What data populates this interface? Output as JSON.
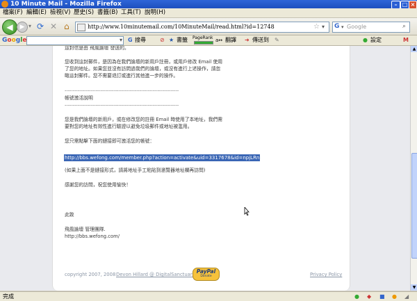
{
  "window": {
    "title": "10 Minute Mail - Mozilla Firefox"
  },
  "menu": [
    "檔案(F)",
    "編輯(E)",
    "檢視(V)",
    "歷史(S)",
    "書籤(B)",
    "工具(T)",
    "說明(H)"
  ],
  "nav": {
    "url": "http://www.10minutemail.com/10MinuteMail/read.html?id=12748",
    "search_placeholder": "Google",
    "search_engine": "G"
  },
  "google_toolbar": {
    "logo": "Google",
    "search_label": "搜尋",
    "bookmarks_label": "書籤",
    "pagerank_label": "PageRank",
    "translate_label": "翻譯",
    "sendto_label": "傳送到",
    "settings_label": "設定",
    "gmail_label": "M"
  },
  "mail": {
    "top_line": "這封信是由 飛風論壇 發送的。",
    "para1": [
      "您收到這封郵件，是因為在我們論壇的新用戶註冊，或用戶修改 Email 使用",
      "了您的地址。如果您並沒有訪問過我們的論壇，或沒有進行上述操作，請忽",
      "略這封郵件。您不需要退訂或進行其他進一步的操作。"
    ],
    "separator": "----------------------------------------------------------------------",
    "section_title": "帳號激活說明",
    "para2": [
      "您是我們論壇的新用戶，或在修改您的註冊 Email 時使用了本地址，我們需",
      "要對您的地址有效性進行驗證以避免垃圾郵件或地址被濫用。"
    ],
    "para3": "您只需點擊下面的鏈接即可激活您的帳號：",
    "activation_link": "http://bbs.wefong.com/member.php?action=activate&uid=3317678&id=npjLRn",
    "para4": "(如果上面不是鏈接形式，請將地址手工粘貼到瀏覽器地址欄再訪問)",
    "para5": "感謝您的訪問，祝您使用愉快！",
    "closing": "此致",
    "signature": "飛風論壇 管理團隊.",
    "site_url": "http://bbs.wefong.com/"
  },
  "footer": {
    "copyright": "copyright 2007, 2008",
    "author_link": "Devon Hillard @ DigitalSanctuary",
    "paypal": "PayPal",
    "donate": "Donate",
    "privacy": "Privacy Policy"
  },
  "status": {
    "text": "完成"
  }
}
